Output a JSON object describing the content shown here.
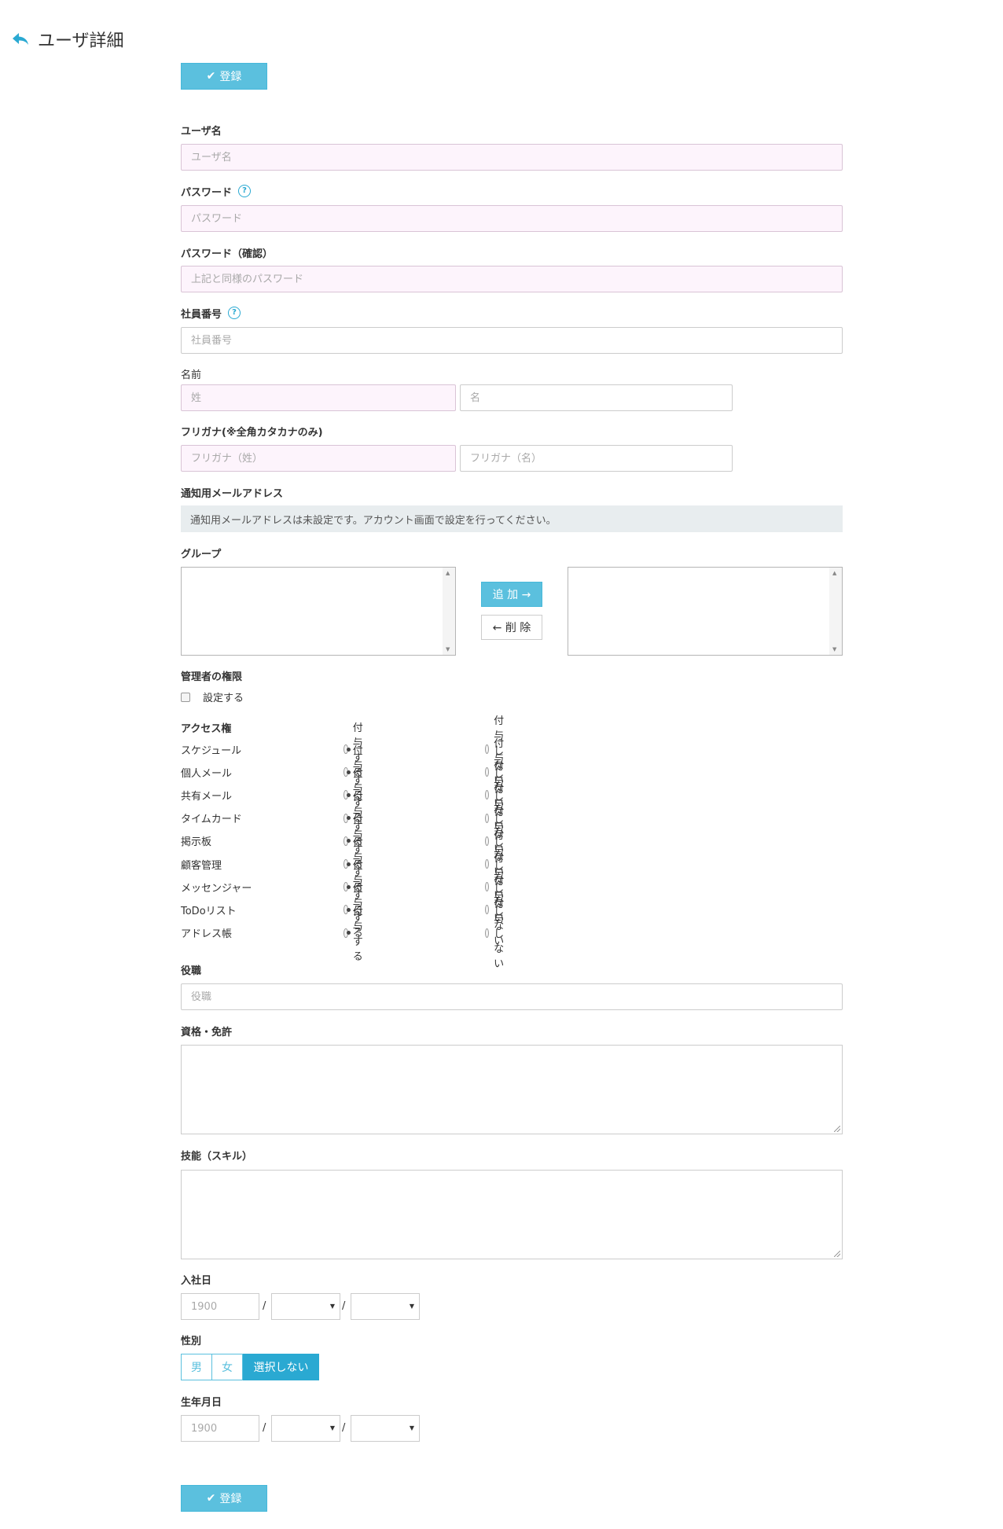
{
  "header": {
    "title": "ユーザ詳細",
    "back_icon": "reply-arrow-icon"
  },
  "submit_label": "登録",
  "fields": {
    "username": {
      "label": "ユーザ名",
      "placeholder": "ユーザ名"
    },
    "password": {
      "label": "パスワード",
      "placeholder": "パスワード"
    },
    "password_confirm": {
      "label": "パスワード（確認）",
      "placeholder": "上記と同様のパスワード"
    },
    "employee_no": {
      "label": "社員番号",
      "placeholder": "社員番号"
    },
    "name": {
      "label": "名前",
      "last_placeholder": "姓",
      "first_placeholder": "名"
    },
    "kana": {
      "label": "フリガナ(※全角カタカナのみ)",
      "last_placeholder": "フリガナ（姓）",
      "first_placeholder": "フリガナ（名）"
    },
    "notify_email": {
      "label": "通知用メールアドレス",
      "notice": "通知用メールアドレスは未設定です。アカウント画面で設定を行ってください。"
    },
    "group": {
      "label": "グループ",
      "add_label": "追 加 →",
      "remove_label": "← 削 除"
    },
    "admin": {
      "label": "管理者の権限",
      "checkbox_label": "設定する"
    },
    "access": {
      "label": "アクセス権",
      "grant_label": "付与する",
      "deny_label": "付与しない",
      "items": [
        "スケジュール",
        "個人メール",
        "共有メール",
        "タイムカード",
        "掲示板",
        "顧客管理",
        "メッセンジャー",
        "ToDoリスト",
        "アドレス帳"
      ]
    },
    "position": {
      "label": "役職",
      "placeholder": "役職"
    },
    "qualification": {
      "label": "資格・免許"
    },
    "skill": {
      "label": "技能（スキル）"
    },
    "hire_date": {
      "label": "入社日",
      "year_placeholder": "1900",
      "sep": "/"
    },
    "gender": {
      "label": "性別",
      "options": [
        "男",
        "女",
        "選択しない"
      ],
      "selected": "選択しない"
    },
    "birth_date": {
      "label": "生年月日",
      "year_placeholder": "1900",
      "sep": "/"
    }
  }
}
